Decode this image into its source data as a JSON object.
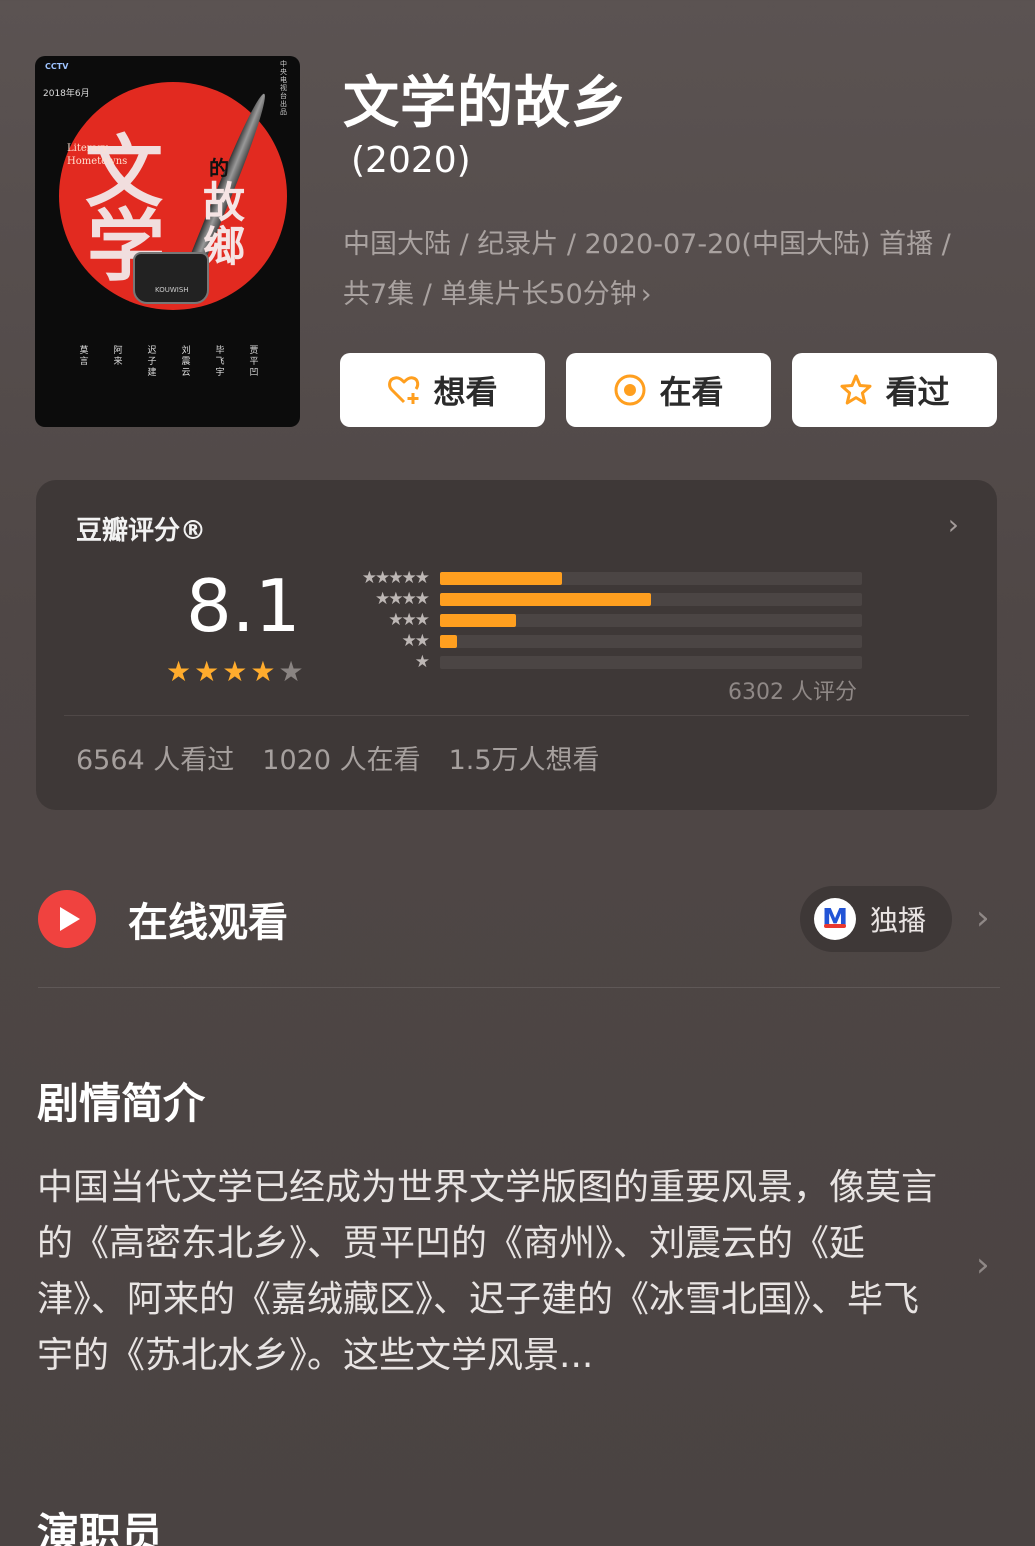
{
  "poster": {
    "channel": "CCTV",
    "date": "2018年6月",
    "credit": "中央电视台出品",
    "title_big_1": "文",
    "title_big_2": "学",
    "title_english": "Literary Hometowns",
    "title_de": "的",
    "title_guxiang": "故鄉",
    "ink_label": "KOUWISH",
    "authors": [
      "莫言",
      "阿来",
      "迟子建",
      "刘震云",
      "毕飞宇",
      "贾平凹"
    ]
  },
  "movie": {
    "title": "文学的故乡",
    "year": "(2020)",
    "meta_line1": "中国大陆 / 纪录片 / 2020-07-20(中国大陆) 首播 /",
    "meta_line2": "共7集 / 单集片长50分钟"
  },
  "actions": {
    "want": "想看",
    "watching": "在看",
    "watched": "看过"
  },
  "rating": {
    "label": "豆瓣评分®",
    "score": "8.1",
    "stars": 4,
    "star_max": 5,
    "distribution": [
      {
        "stars": "★★★★★",
        "fraction": 0.29
      },
      {
        "stars": "★★★★",
        "fraction": 0.5
      },
      {
        "stars": "★★★",
        "fraction": 0.18
      },
      {
        "stars": "★★",
        "fraction": 0.04
      },
      {
        "stars": "★",
        "fraction": 0.0
      }
    ],
    "count": "6302 人评分",
    "stats": {
      "watched": "6564 人看过",
      "watching": "1020 人在看",
      "want": "1.5万人想看"
    }
  },
  "online": {
    "title": "在线观看",
    "exclusive": "独播"
  },
  "synopsis": {
    "title": "剧情简介",
    "text": "中国当代文学已经成为世界文学版图的重要风景，像莫言的《高密东北乡》、贾平凹的《商州》、刘震云的《延津》、阿来的《嘉绒藏区》、迟子建的《冰雪北国》、毕飞宇的《苏北水乡》。这些文学风景..."
  },
  "cast": {
    "title": "演职员"
  },
  "colors": {
    "accent_orange": "#ff9f1f",
    "play_red": "#f0423f",
    "card_bg": "#3e3837"
  }
}
